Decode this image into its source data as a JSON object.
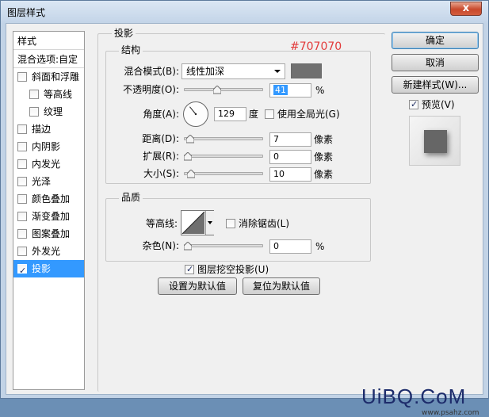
{
  "window": {
    "title": "图层样式",
    "close": "x"
  },
  "styles_list": {
    "header": "样式",
    "items": [
      {
        "label": "混合选项:自定",
        "checkbox": false,
        "checked": false,
        "indent": false,
        "selected": false
      },
      {
        "label": "斜面和浮雕",
        "checkbox": true,
        "checked": false,
        "indent": false,
        "selected": false
      },
      {
        "label": "等高线",
        "checkbox": true,
        "checked": false,
        "indent": true,
        "selected": false
      },
      {
        "label": "纹理",
        "checkbox": true,
        "checked": false,
        "indent": true,
        "selected": false
      },
      {
        "label": "描边",
        "checkbox": true,
        "checked": false,
        "indent": false,
        "selected": false
      },
      {
        "label": "内阴影",
        "checkbox": true,
        "checked": false,
        "indent": false,
        "selected": false
      },
      {
        "label": "内发光",
        "checkbox": true,
        "checked": false,
        "indent": false,
        "selected": false
      },
      {
        "label": "光泽",
        "checkbox": true,
        "checked": false,
        "indent": false,
        "selected": false
      },
      {
        "label": "颜色叠加",
        "checkbox": true,
        "checked": false,
        "indent": false,
        "selected": false
      },
      {
        "label": "渐变叠加",
        "checkbox": true,
        "checked": false,
        "indent": false,
        "selected": false
      },
      {
        "label": "图案叠加",
        "checkbox": true,
        "checked": false,
        "indent": false,
        "selected": false
      },
      {
        "label": "外发光",
        "checkbox": true,
        "checked": false,
        "indent": false,
        "selected": false
      },
      {
        "label": "投影",
        "checkbox": true,
        "checked": true,
        "indent": false,
        "selected": true
      }
    ]
  },
  "drop_shadow": {
    "title": "投影",
    "structure": {
      "title": "结构",
      "blend_mode_label": "混合模式(B):",
      "blend_mode_value": "线性加深",
      "color": "#707070",
      "color_annotation": "#707070",
      "opacity_label": "不透明度(O):",
      "opacity_value": "41",
      "opacity_fraction": 0.41,
      "percent": "%",
      "angle_label": "角度(A):",
      "angle_value": "129",
      "angle_degrees": 129,
      "degree_unit": "度",
      "global_light_label": "使用全局光(G)",
      "global_light_checked": false,
      "distance_label": "距离(D):",
      "distance_value": "7",
      "distance_fraction": 0.03,
      "spread_label": "扩展(R):",
      "spread_value": "0",
      "spread_fraction": 0.0,
      "size_label": "大小(S):",
      "size_value": "10",
      "size_fraction": 0.04,
      "pixels_unit": "像素"
    },
    "quality": {
      "title": "品质",
      "contour_label": "等高线:",
      "anti_alias_label": "消除锯齿(L)",
      "anti_alias_checked": false,
      "noise_label": "杂色(N):",
      "noise_value": "0",
      "noise_fraction": 0.0,
      "percent": "%"
    },
    "knockout_label": "图层挖空投影(U)",
    "knockout_checked": true,
    "make_default": "设置为默认值",
    "reset_default": "复位为默认值"
  },
  "actions": {
    "ok": "确定",
    "cancel": "取消",
    "new_style": "新建样式(W)...",
    "preview_label": "预览(V)",
    "preview_checked": true
  },
  "watermark": {
    "brand": "UiBQ.CoM",
    "url": "www.psahz.com"
  }
}
